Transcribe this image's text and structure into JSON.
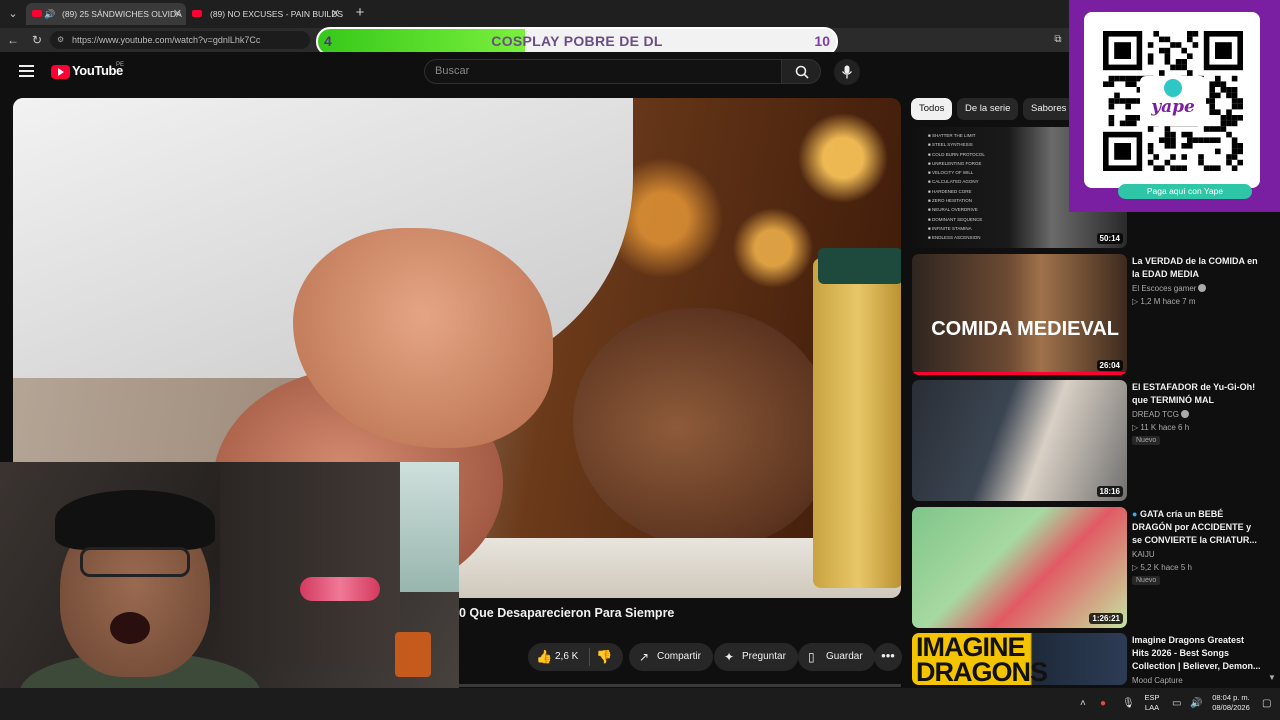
{
  "browser": {
    "tabs": [
      {
        "title": "(89) 25 SÁNDWICHES OLVIDA",
        "active": true
      },
      {
        "title": "(89) NO EXCUSES - PAIN BUILDS F",
        "active": false
      }
    ],
    "url": "https://www.youtube.com/watch?v=gdnlLhk7Cc"
  },
  "goal_bar": {
    "start": "4",
    "label": "COSPLAY POBRE DE DL",
    "end": "10",
    "progress_fraction": 0.4
  },
  "header": {
    "logo_text": "YouTube",
    "region": "PE",
    "search_placeholder": "Buscar"
  },
  "video": {
    "title": "0 Que Desaparecieron Para Siempre",
    "likes": "2,6 K",
    "share_label": "Compartir",
    "ask_label": "Preguntar",
    "save_label": "Guardar"
  },
  "chips": [
    "Todos",
    "De la serie",
    "Sabores"
  ],
  "recommended": [
    {
      "title": "",
      "channel": "",
      "meta": "",
      "duration": "50:14",
      "thumb_lines": [
        "SHATTER THE LIMIT",
        "STEEL SYNTHESIS",
        "COLD BURN PROTOCOL",
        "UNRELENTING FORGE",
        "VELOCITY OF WILL",
        "CALCULATED AGONY",
        "HARDENED CORE",
        "ZERO HESITATION",
        "NEURAL OVERDRIVE",
        "DOMINANT SEQUENCE",
        "INFINITE STAMINA",
        "ENDLESS ASCENSION"
      ]
    },
    {
      "title": "La VERDAD de la COMIDA en la EDAD MEDIA",
      "channel": "El Escoces gamer",
      "meta": "1,2 M  hace 7 m",
      "duration": "26:04",
      "thumb_text": "COMIDA MEDIEVAL"
    },
    {
      "title": "El ESTAFADOR de Yu-Gi-Oh! que TERMINÓ MAL",
      "channel": "DREAD TCG",
      "meta": "11 K  hace 6 h",
      "badge": "Nuevo",
      "duration": "18:16"
    },
    {
      "title": "GATA cría un BEBÉ DRAGÓN por ACCIDENTE y se CONVIERTE la CRIATUR...",
      "channel": "KAIJU",
      "meta": "5,2 K  hace 5 h",
      "badge": "Nuevo",
      "duration": "1:26:21"
    },
    {
      "title": "Imagine Dragons Greatest Hits 2026 - Best Songs Collection | Believer, Demon...",
      "channel": "Mood Capture",
      "thumb_text": "IMAGINE DRAGONS"
    }
  ],
  "qr": {
    "brand": "yape",
    "cta": "Paga aquí con Yape"
  },
  "taskbar": {
    "lang_line1": "ESP",
    "lang_line2": "LAA",
    "time": "08:04 p. m.",
    "date": "08/08/2026"
  },
  "colors": {
    "youtube_red": "#ff0033",
    "yape_purple": "#7b1fa2",
    "goal_green": "#36c81a"
  }
}
